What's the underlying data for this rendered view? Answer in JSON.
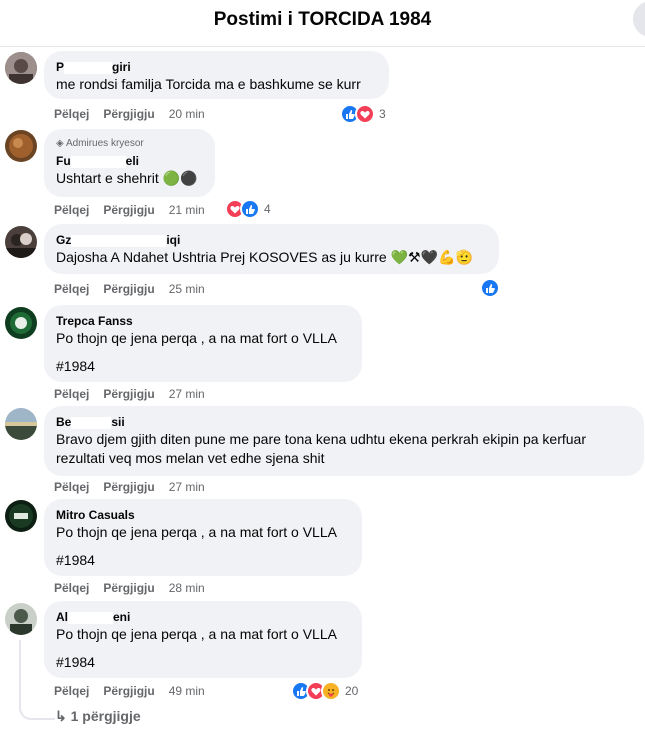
{
  "header": {
    "title": "Postimi i TORCIDA 1984"
  },
  "actions": {
    "like": "Pëlqej",
    "reply": "Përgjigju"
  },
  "comments": [
    {
      "author_start": "P",
      "author_end": "giri",
      "text": [
        "me rondsi familja Torcida ma e bashkume se kurr"
      ],
      "time": "20 min",
      "count": "3"
    },
    {
      "badge": "Admirues kryesor",
      "author_start": "Fu",
      "author_end": "eli",
      "text": [
        "Ushtart e shehrit 🟢⚫"
      ],
      "time": "21 min",
      "count": "4"
    },
    {
      "author_start": "Gz",
      "author_end": "iqi",
      "text": [
        "Dajosha A Ndahet Ushtria Prej KOSOVES as ju kurre 💚⚒🖤💪🫡"
      ],
      "time": "25 min",
      "count": ""
    },
    {
      "author": "Trepca Fanss",
      "text": [
        "Po thojn qe jena perqa , a na mat fort o VLLA",
        "#1984"
      ],
      "time": "27 min"
    },
    {
      "author_start": "Be",
      "author_end": "sii",
      "text": [
        "Bravo djem gjith diten pune me pare tona kena udhtu ekena perkrah ekipin pa kerfuar rezultati veq mos melan vet edhe sjena shit"
      ],
      "time": "27 min"
    },
    {
      "author": "Mitro Casuals",
      "text": [
        "Po thojn qe jena perqa , a na mat fort o VLLA",
        "#1984"
      ],
      "time": "28 min"
    },
    {
      "author_start": "Al",
      "author_end": "eni",
      "text": [
        "Po thojn qe jena perqa , a na mat fort o VLLA",
        "#1984"
      ],
      "time": "49 min",
      "count": "20"
    }
  ],
  "replies_link": "↳ 1 përgjigje",
  "colors": {
    "like": "#1877f2",
    "love": "#f33e58",
    "care": "#f7b125",
    "bubble": "#f0f2f5"
  }
}
